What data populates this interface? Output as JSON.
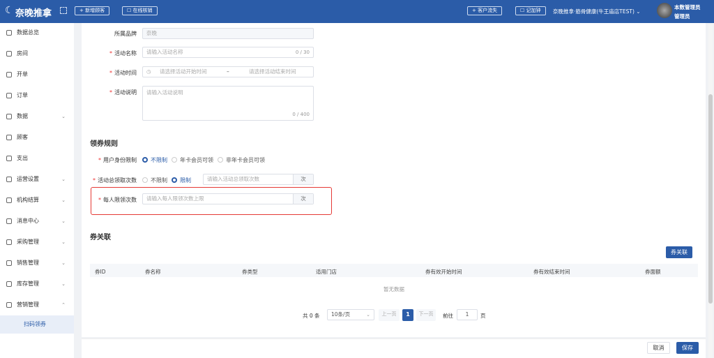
{
  "header": {
    "brand": "奈晚推拿",
    "new_customer": "+ 新增顾客",
    "online_verify": "在线核销",
    "customer_loss": "+ 客户流失",
    "bonus": "记加钟",
    "store": "奈晚推拿·筋骨健康(牛王庙店TEST)",
    "user_name": "本数管理员",
    "user_role": "管理员"
  },
  "sidebar": {
    "items": [
      {
        "label": "数据总览"
      },
      {
        "label": "房间"
      },
      {
        "label": "开单"
      },
      {
        "label": "订单"
      },
      {
        "label": "数据"
      },
      {
        "label": "顾客"
      },
      {
        "label": "支出"
      },
      {
        "label": "运营设置"
      },
      {
        "label": "机构结算"
      },
      {
        "label": "消息中心"
      },
      {
        "label": "采购管理"
      },
      {
        "label": "销售管理"
      },
      {
        "label": "库存管理"
      },
      {
        "label": "营销管理"
      }
    ],
    "active": "扫码领券"
  },
  "form": {
    "brand_label": "所属品牌",
    "brand_value": "奈晚",
    "name_label": "活动名称",
    "name_placeholder": "请输入活动名称",
    "name_count": "0 / 30",
    "time_label": "活动时间",
    "time_start": "请选择活动开始时间",
    "time_sep": "–",
    "time_end": "请选择活动结束时间",
    "desc_label": "活动说明",
    "desc_placeholder": "请输入活动说明",
    "desc_count": "0 / 400"
  },
  "rules": {
    "title": "领券规则",
    "identity_label": "用户身份限制",
    "identity_options": [
      "不限制",
      "年卡会员可领",
      "非年卡会员可领"
    ],
    "total_label": "活动总领取次数",
    "total_options": [
      "不限制",
      "限制"
    ],
    "total_placeholder": "请输入活动总领取次数",
    "unit": "次",
    "per_label": "每人限领次数",
    "per_placeholder": "请输入每人限领次数上限"
  },
  "coupons": {
    "title": "券关联",
    "button": "券关联",
    "columns": [
      "券ID",
      "券名称",
      "券类型",
      "适用门店",
      "券有效开始时间",
      "券有效结束时间",
      "券面额"
    ],
    "empty": "暂无数据"
  },
  "pagination": {
    "total": "共 0 条",
    "page_size": "10条/页",
    "prev": "上一页",
    "current": "1",
    "next": "下一页",
    "goto": "前往",
    "goto_value": "1",
    "page_unit": "页"
  },
  "footer": {
    "cancel": "取消",
    "save": "保存"
  }
}
